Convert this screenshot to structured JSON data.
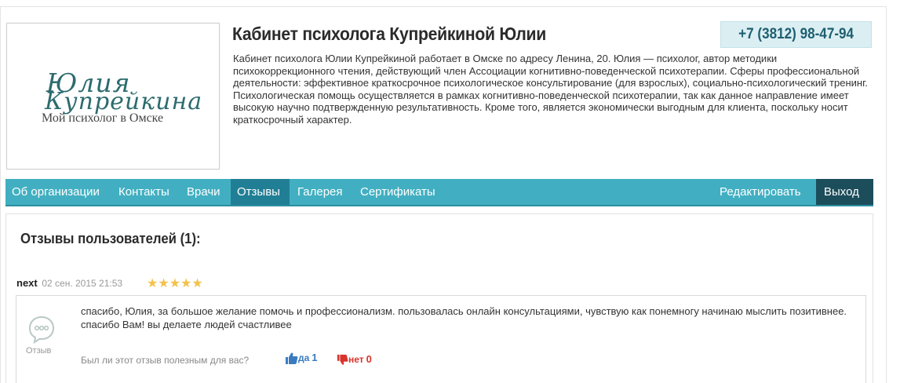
{
  "logo": {
    "line1": "Юлия",
    "line2": "Купрейкина",
    "subtitle": "Мой психолог в Омске"
  },
  "header": {
    "title": "Кабинет психолога Купрейкиной Юлии",
    "phone": "+7 (3812) 98-47-94",
    "description": "Кабинет психолога Юлии Купрейкиной работает в Омске по адресу Ленина, 20. Юлия — психолог, автор методики психокоррекционного чтения, действующий член Ассоциации когнитивно-поведенческой психотерапии. Сферы профессиональной деятельности: эффективное краткосрочное психологическое консультирование (для взрослых), социально-психологический тренинг. Психологическая помощь осуществляется в рамках когнитивно-поведенческой психотерапии, так как данное направление имеет высокую научно подтвержденную результативность. Кроме того, является экономически выгодным для клиента, поскольку носит краткосрочный характер."
  },
  "nav": {
    "items": [
      {
        "label": "Об организации"
      },
      {
        "label": "Контакты"
      },
      {
        "label": "Врачи"
      },
      {
        "label": "Отзывы"
      },
      {
        "label": "Галерея"
      },
      {
        "label": "Сертификаты"
      }
    ],
    "edit_label": "Редактировать",
    "exit_label": "Выход",
    "active_item": "Отзывы"
  },
  "reviews": {
    "heading": "Отзывы пользователей (1):",
    "items": [
      {
        "author": "next",
        "date": "02 сен. 2015 21:53",
        "stars": "★★★★★",
        "rating": 5,
        "icon_label": "Отзыв",
        "text": "спасибо, Юлия, за большое желание помочь и профессионализм. пользовалась онлайн консультациями, чувствую как понемногу начинаю мыслить позитивнее. спасибо Вам! вы делаете людей счастливее",
        "helpful_question": "Был ли этот отзыв полезным для вас?",
        "yes_label": "да",
        "yes_count": "1",
        "no_label": "нет",
        "no_count": "0"
      }
    ]
  },
  "colors": {
    "nav_bg": "#41afc1",
    "nav_active": "#217f95",
    "nav_exit": "#1c4d5b",
    "phone_bg": "#dbeff3",
    "logo_text": "#2d6b6e",
    "star": "#f2c24b",
    "yes": "#3a7bbf",
    "no": "#d9342b"
  }
}
